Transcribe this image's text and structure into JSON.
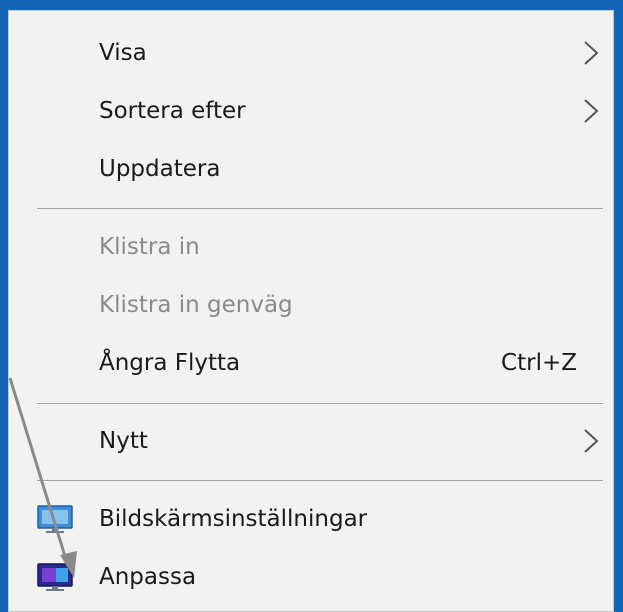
{
  "menu": {
    "items": [
      {
        "label": "Visa",
        "icon": "chevron-right-icon"
      },
      {
        "label": "Sortera efter",
        "icon": "chevron-right-icon"
      },
      {
        "label": "Uppdatera"
      },
      {
        "label": "Klistra in",
        "disabled": true
      },
      {
        "label": "Klistra in genväg",
        "disabled": true
      },
      {
        "label": "Ångra Flytta",
        "shortcut": "Ctrl+Z"
      },
      {
        "label": "Nytt",
        "icon": "chevron-right-icon"
      },
      {
        "label": "Bildskärmsinställningar",
        "icon": "display-settings-icon"
      },
      {
        "label": "Anpassa",
        "icon": "personalize-icon"
      }
    ]
  },
  "colors": {
    "desktop_blue": "#1565b8",
    "menu_bg": "#f2f2f2",
    "disabled_text": "#8a8a8a",
    "separator": "#a3a3a3"
  }
}
